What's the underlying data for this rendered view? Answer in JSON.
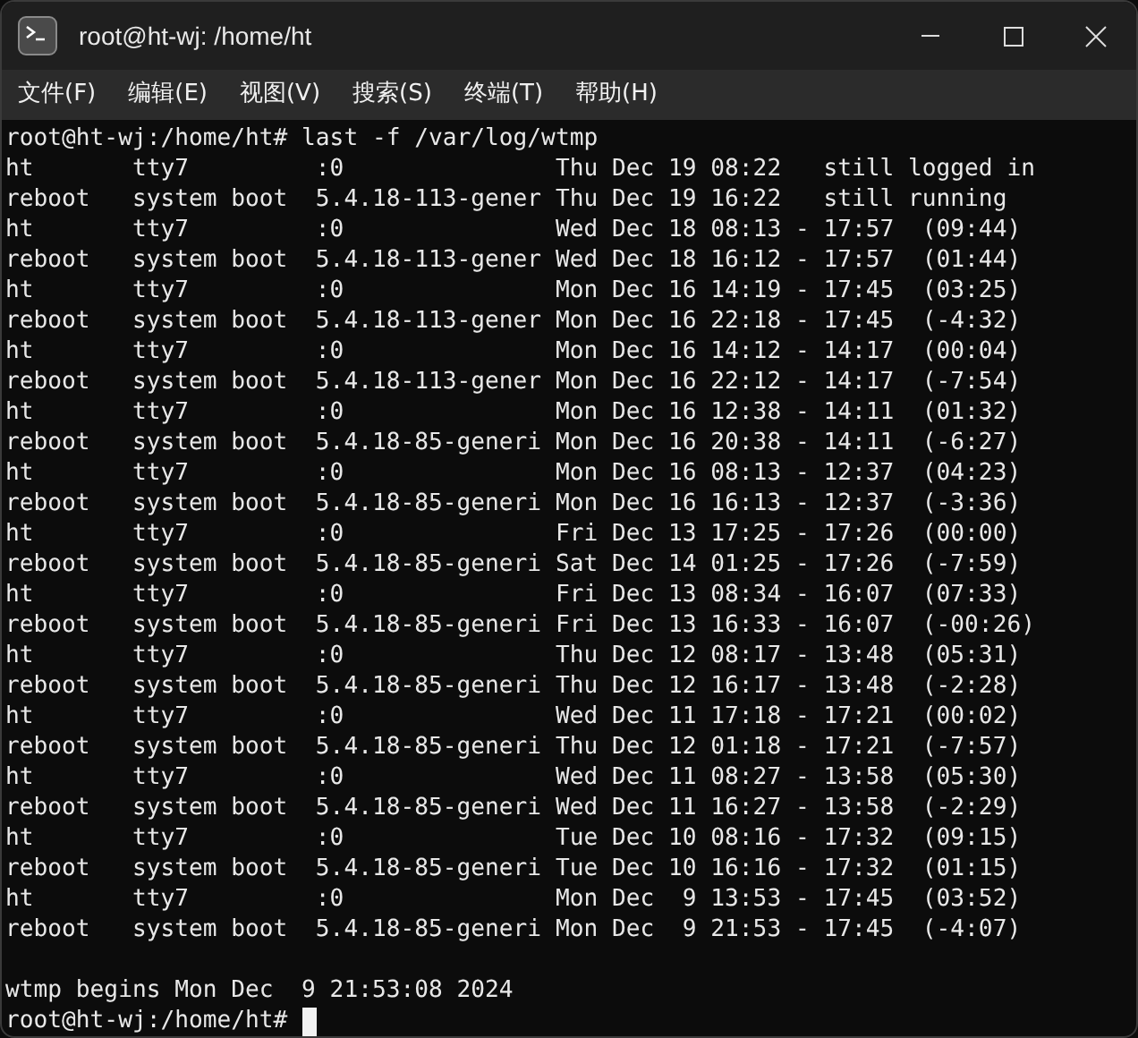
{
  "window": {
    "title": "root@ht-wj: /home/ht"
  },
  "menu": [
    "文件(F)",
    "编辑(E)",
    "视图(V)",
    "搜索(S)",
    "终端(T)",
    "帮助(H)"
  ],
  "terminal": {
    "command_line": "root@ht-wj:/home/ht# last -f /var/log/wtmp",
    "output": [
      "ht       tty7         :0               Thu Dec 19 08:22   still logged in",
      "reboot   system boot  5.4.18-113-gener Thu Dec 19 16:22   still running",
      "ht       tty7         :0               Wed Dec 18 08:13 - 17:57  (09:44)",
      "reboot   system boot  5.4.18-113-gener Wed Dec 18 16:12 - 17:57  (01:44)",
      "ht       tty7         :0               Mon Dec 16 14:19 - 17:45  (03:25)",
      "reboot   system boot  5.4.18-113-gener Mon Dec 16 22:18 - 17:45  (-4:32)",
      "ht       tty7         :0               Mon Dec 16 14:12 - 14:17  (00:04)",
      "reboot   system boot  5.4.18-113-gener Mon Dec 16 22:12 - 14:17  (-7:54)",
      "ht       tty7         :0               Mon Dec 16 12:38 - 14:11  (01:32)",
      "reboot   system boot  5.4.18-85-generi Mon Dec 16 20:38 - 14:11  (-6:27)",
      "ht       tty7         :0               Mon Dec 16 08:13 - 12:37  (04:23)",
      "reboot   system boot  5.4.18-85-generi Mon Dec 16 16:13 - 12:37  (-3:36)",
      "ht       tty7         :0               Fri Dec 13 17:25 - 17:26  (00:00)",
      "reboot   system boot  5.4.18-85-generi Sat Dec 14 01:25 - 17:26  (-7:59)",
      "ht       tty7         :0               Fri Dec 13 08:34 - 16:07  (07:33)",
      "reboot   system boot  5.4.18-85-generi Fri Dec 13 16:33 - 16:07  (-00:26)",
      "ht       tty7         :0               Thu Dec 12 08:17 - 13:48  (05:31)",
      "reboot   system boot  5.4.18-85-generi Thu Dec 12 16:17 - 13:48  (-2:28)",
      "ht       tty7         :0               Wed Dec 11 17:18 - 17:21  (00:02)",
      "reboot   system boot  5.4.18-85-generi Thu Dec 12 01:18 - 17:21  (-7:57)",
      "ht       tty7         :0               Wed Dec 11 08:27 - 13:58  (05:30)",
      "reboot   system boot  5.4.18-85-generi Wed Dec 11 16:27 - 13:58  (-2:29)",
      "ht       tty7         :0               Tue Dec 10 08:16 - 17:32  (09:15)",
      "reboot   system boot  5.4.18-85-generi Tue Dec 10 16:16 - 17:32  (01:15)",
      "ht       tty7         :0               Mon Dec  9 13:53 - 17:45  (03:52)",
      "reboot   system boot  5.4.18-85-generi Mon Dec  9 21:53 - 17:45  (-4:07)"
    ],
    "summary": "wtmp begins Mon Dec  9 21:53:08 2024",
    "prompt": "root@ht-wj:/home/ht#"
  }
}
